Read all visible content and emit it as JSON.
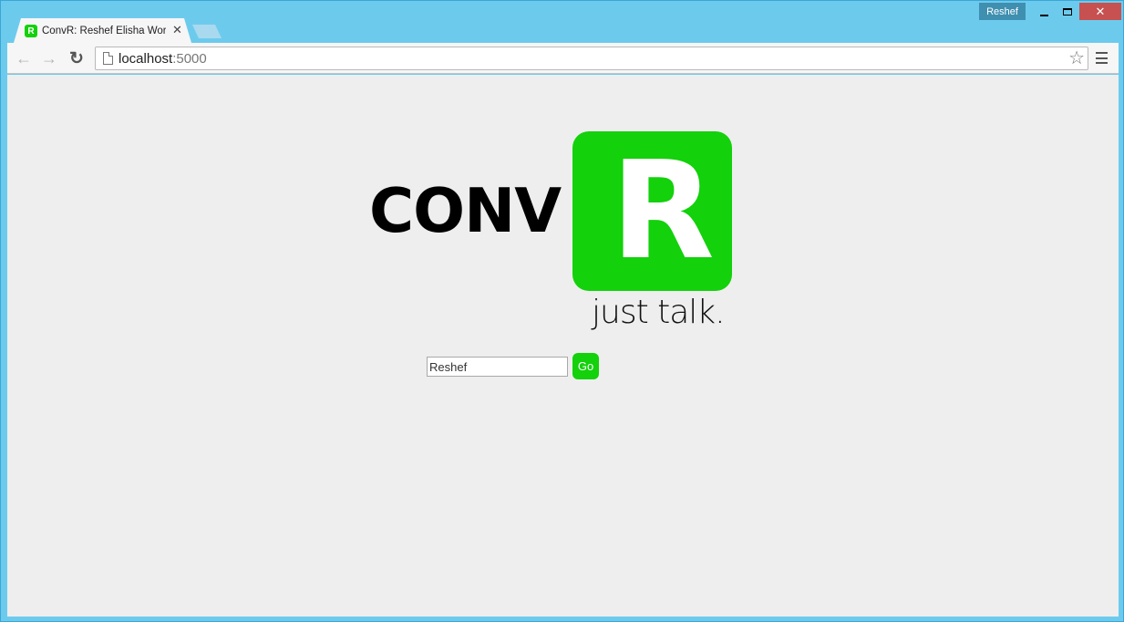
{
  "window": {
    "profile_name": "Reshef",
    "minimize_icon": "minimize-icon",
    "maximize_icon": "maximize-icon",
    "close_icon": "close-icon",
    "close_glyph": "✕"
  },
  "tabs": [
    {
      "title": "ConvR: Reshef Elisha Worl",
      "favicon": "R",
      "close_glyph": "✕"
    }
  ],
  "toolbar": {
    "back_glyph": "←",
    "forward_glyph": "→",
    "reload_glyph": "↻",
    "url_host": "localhost",
    "url_port": ":5000",
    "star_glyph": "☆"
  },
  "page": {
    "logo_text": "CONV",
    "logo_letter": "R",
    "tagline": "just talk.",
    "name_input_value": "Reshef",
    "go_label": "Go",
    "accent_color": "#13d10b"
  }
}
